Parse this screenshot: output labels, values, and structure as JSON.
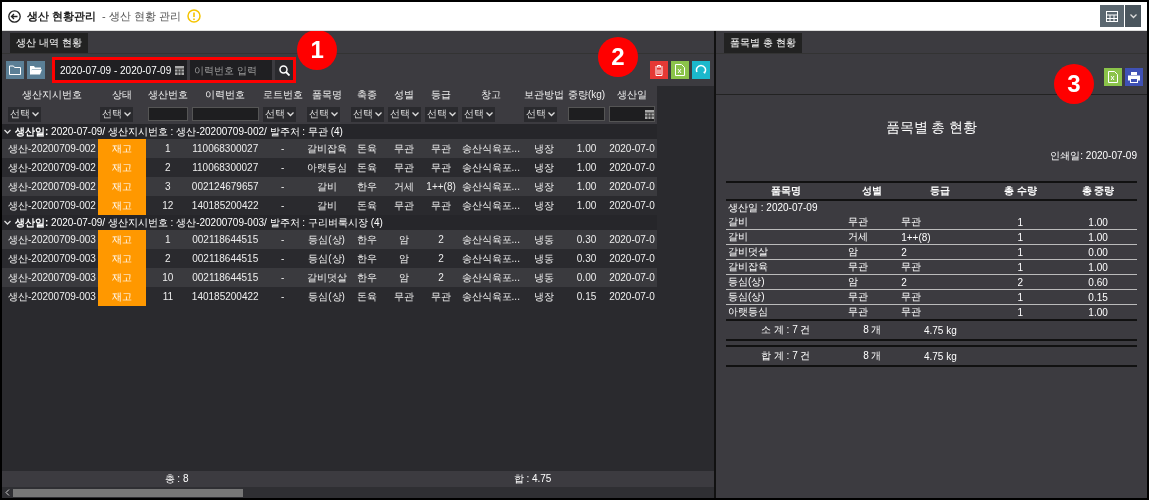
{
  "header": {
    "title": "생산 현황관리",
    "subtitle": "- 생산 현황 관리"
  },
  "callouts": [
    {
      "label": "1"
    },
    {
      "label": "2"
    },
    {
      "label": "3"
    }
  ],
  "left_panel": {
    "tab": "생산 내역 현황",
    "date_range": "2020-07-09 - 2020-07-09",
    "search": {
      "placeholder": "이력번호 입력"
    },
    "columns": [
      "생산지시번호",
      "상태",
      "생산번호",
      "이력번호",
      "로트번호",
      "품목명",
      "축종",
      "성별",
      "등급",
      "창고",
      "보관방법",
      "중량(kg)",
      "생산일"
    ],
    "filters": [
      {
        "kind": "select",
        "value": "선택"
      },
      {
        "kind": "select",
        "value": "선택"
      },
      {
        "kind": "input"
      },
      {
        "kind": "input"
      },
      {
        "kind": "select",
        "value": "선택"
      },
      {
        "kind": "select",
        "value": "선택"
      },
      {
        "kind": "select",
        "value": "선택"
      },
      {
        "kind": "select",
        "value": "선택"
      },
      {
        "kind": "select",
        "value": "선택"
      },
      {
        "kind": "select",
        "value": "선택"
      },
      {
        "kind": "select",
        "value": "선택"
      },
      {
        "kind": "input"
      },
      {
        "kind": "date"
      }
    ],
    "groups": [
      {
        "title": "**생산일:** 2020-07-09/ 생산지시번호 : 생산-20200709-002/ 발주처 : 무관 (4)",
        "expanded": true,
        "rows": [
          {
            "order": "생산-20200709-002",
            "status": "재고",
            "cells": [
              "1",
              "110068300027",
              "-",
              "갈비잡육",
              "돈육",
              "무관",
              "무관",
              "송산식육포...",
              "냉장",
              "1.00",
              "2020-07-0"
            ]
          },
          {
            "order": "생산-20200709-002",
            "status": "재고",
            "cells": [
              "2",
              "110068300027",
              "-",
              "아랫등심",
              "돈육",
              "무관",
              "무관",
              "송산식육포...",
              "냉장",
              "1.00",
              "2020-07-0"
            ]
          },
          {
            "order": "생산-20200709-002",
            "status": "재고",
            "cells": [
              "3",
              "002124679657",
              "-",
              "갈비",
              "한우",
              "거세",
              "1++(8)",
              "송산식육포...",
              "냉장",
              "1.00",
              "2020-07-0"
            ]
          },
          {
            "order": "생산-20200709-002",
            "status": "재고",
            "cells": [
              "12",
              "140185200422",
              "-",
              "갈비",
              "돈육",
              "무관",
              "무관",
              "송산식육포...",
              "냉장",
              "1.00",
              "2020-07-0"
            ]
          }
        ]
      },
      {
        "title": "**생산일:** 2020-07-09/ 생산지시번호 : 생산-20200709-003/ 발주처 : 구리벼룩시장 (4)",
        "expanded": true,
        "rows": [
          {
            "order": "생산-20200709-003",
            "status": "재고",
            "cells": [
              "1",
              "002118644515",
              "-",
              "등심(상)",
              "한우",
              "암",
              "2",
              "송산식육포...",
              "냉동",
              "0.30",
              "2020-07-0"
            ]
          },
          {
            "order": "생산-20200709-003",
            "status": "재고",
            "cells": [
              "2",
              "002118644515",
              "-",
              "등심(상)",
              "한우",
              "암",
              "2",
              "송산식육포...",
              "냉동",
              "0.30",
              "2020-07-0"
            ]
          },
          {
            "order": "생산-20200709-003",
            "status": "재고",
            "cells": [
              "10",
              "002118644515",
              "-",
              "갈비덧살",
              "한우",
              "암",
              "2",
              "송산식육포...",
              "냉동",
              "0.00",
              "2020-07-0"
            ]
          },
          {
            "order": "생산-20200709-003",
            "status": "재고",
            "cells": [
              "11",
              "140185200422",
              "-",
              "등심(상)",
              "돈육",
              "무관",
              "무관",
              "송산식육포...",
              "냉장",
              "0.15",
              "2020-07-0"
            ]
          }
        ]
      }
    ],
    "footer": {
      "count": "총 : 8",
      "sum": "합 : 4.75"
    }
  },
  "right_panel": {
    "tab": "품목별 총 현황",
    "report": {
      "title": "품목별 총 현황",
      "print_date": "인쇄일: 2020-07-09",
      "columns": [
        "품목명",
        "성별",
        "등급",
        "총 수량",
        "총 중량"
      ],
      "date_label": "생산일 : 2020-07-09",
      "rows": [
        [
          "갈비",
          "무관",
          "무관",
          "1",
          "1.00"
        ],
        [
          "갈비",
          "거세",
          "1++(8)",
          "1",
          "1.00"
        ],
        [
          "갈비덧살",
          "암",
          "2",
          "1",
          "0.00"
        ],
        [
          "갈비잡육",
          "무관",
          "무관",
          "1",
          "1.00"
        ],
        [
          "등심(상)",
          "암",
          "2",
          "2",
          "0.60"
        ],
        [
          "등심(상)",
          "무관",
          "무관",
          "1",
          "0.15"
        ],
        [
          "아랫등심",
          "무관",
          "무관",
          "1",
          "1.00"
        ]
      ],
      "subtotal": [
        "소 계 : 7 건",
        "8 개",
        "4.75 kg"
      ],
      "total": [
        "합 계 : 7 건",
        "8 개",
        "4.75 kg"
      ]
    }
  }
}
